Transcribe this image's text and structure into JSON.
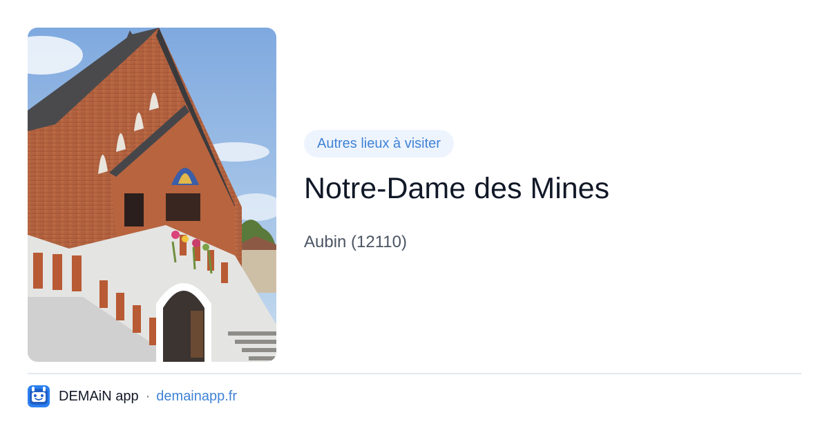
{
  "card": {
    "category_badge": "Autres lieux à visiter",
    "title": "Notre-Dame des Mines",
    "location": "Aubin (12110)",
    "image_alt": "Notre-Dame des Mines"
  },
  "footer": {
    "app_name": "DEMAiN app",
    "separator": "·",
    "site": "demainapp.fr",
    "icon": "demain-app-icon"
  },
  "colors": {
    "accent": "#3e82d6",
    "badge_bg": "#eef4fd",
    "title": "#111827",
    "muted": "#4b5563",
    "divider": "#e2e8f0"
  }
}
